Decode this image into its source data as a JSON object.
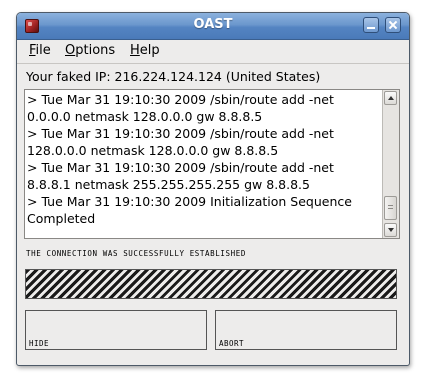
{
  "window": {
    "title": "OAST"
  },
  "menu": {
    "file": "File",
    "options": "Options",
    "help": "Help"
  },
  "ip_line": "Your faked IP: 216.224.124.124 (United States)",
  "log": {
    "lines": [
      "> Tue Mar 31 19:10:30 2009 /sbin/route add -net",
      "0.0.0.0 netmask 128.0.0.0 gw 8.8.8.5",
      "> Tue Mar 31 19:10:30 2009 /sbin/route add -net",
      "128.0.0.0 netmask 128.0.0.0 gw 8.8.8.5",
      "> Tue Mar 31 19:10:30 2009 /sbin/route add -net",
      "8.8.8.1 netmask 255.255.255.255 gw 8.8.8.5",
      "> Tue Mar 31 19:10:30 2009 Initialization Sequence",
      "Completed"
    ]
  },
  "status": "THE CONNECTION WAS SUCCESSFULLY ESTABLISHED",
  "buttons": {
    "hide": "HIDE",
    "abort": "ABORT"
  },
  "icons": {
    "app": "oast-app-icon",
    "minimize": "minimize-icon",
    "close": "close-icon"
  },
  "colors": {
    "titlebar": "#5484c2",
    "window_bg": "#edeceb"
  }
}
